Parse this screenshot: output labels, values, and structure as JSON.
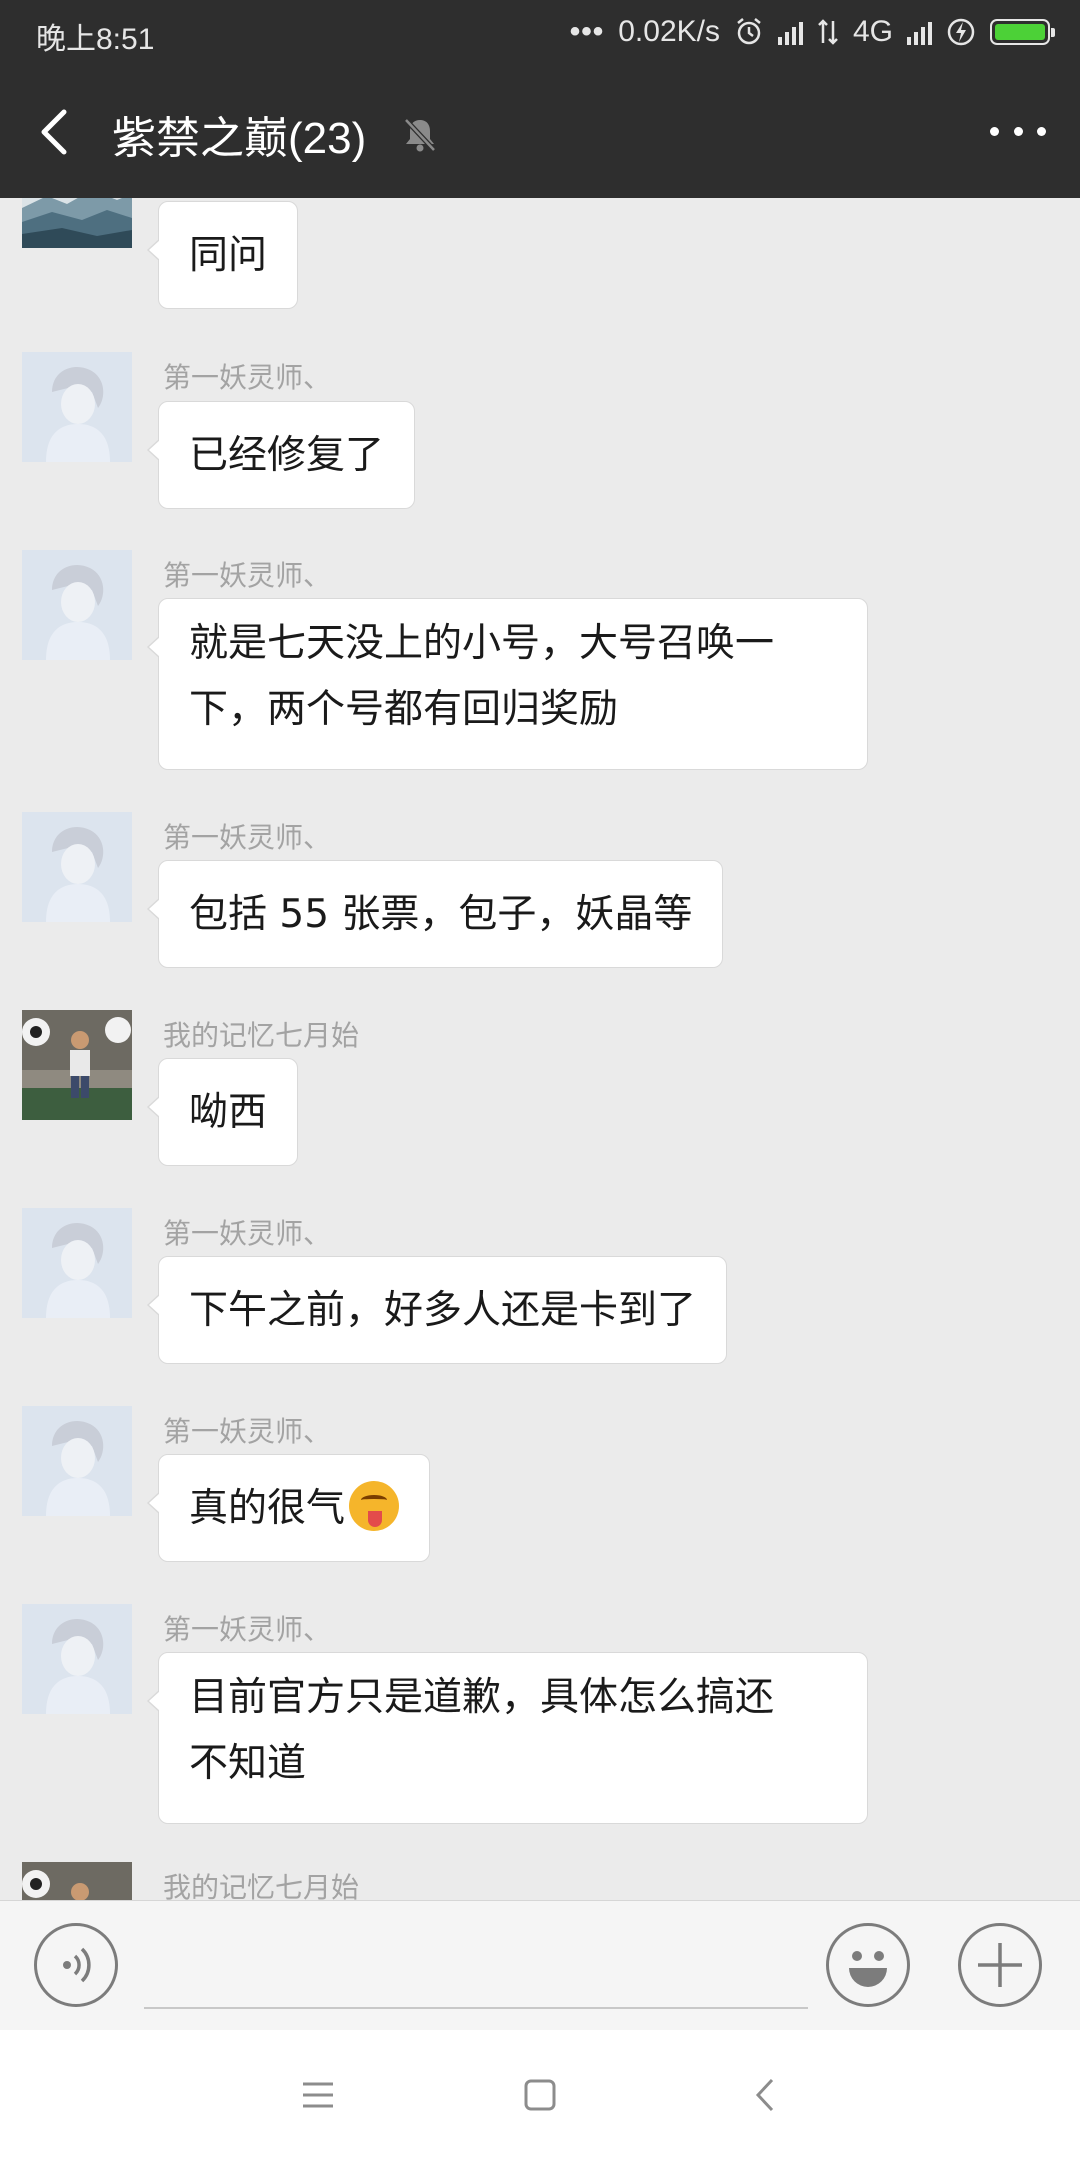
{
  "status_bar": {
    "time": "晚上8:51",
    "more": "•••",
    "net_speed": "0.02K/s",
    "network": "4G"
  },
  "header": {
    "title": "紫禁之巅(23)",
    "back_icon": "back-arrow-icon",
    "mute_icon": "bell-muted-icon",
    "more_icon": "more-dots-icon"
  },
  "messages": [
    {
      "sender": "",
      "text": "同问",
      "avatar": "landscape"
    },
    {
      "sender": "第一妖灵师、",
      "text": "已经修复了",
      "avatar": "anime"
    },
    {
      "sender": "第一妖灵师、",
      "lines": [
        "就是七天没上的小号，大号召唤一",
        "下，两个号都有回归奖励"
      ],
      "avatar": "anime"
    },
    {
      "sender": "第一妖灵师、",
      "text": "包括 55 张票，包子，妖晶等",
      "avatar": "anime"
    },
    {
      "sender": "我的记忆七月始",
      "text": "呦西",
      "avatar": "child"
    },
    {
      "sender": "第一妖灵师、",
      "text": "下午之前，好多人还是卡到了",
      "avatar": "anime"
    },
    {
      "sender": "第一妖灵师、",
      "text": "真的很气",
      "emoji": "tongue-out-emoji",
      "avatar": "anime"
    },
    {
      "sender": "第一妖灵师、",
      "lines": [
        "目前官方只是道歉，具体怎么搞还",
        "不知道"
      ],
      "avatar": "anime"
    },
    {
      "sender": "我的记忆七月始",
      "text": "",
      "avatar": "child"
    }
  ],
  "input_bar": {
    "placeholder": "",
    "voice_icon": "voice-icon",
    "emoji_icon": "emoji-icon",
    "plus_icon": "plus-icon"
  },
  "nav_bar": {
    "menu_icon": "menu-icon",
    "home_icon": "home-icon",
    "back_icon": "back-icon"
  },
  "colors": {
    "header_bg": "#2e2e2e",
    "chat_bg": "#ebebeb",
    "bubble_bg": "#ffffff",
    "sender_text": "#a3a3a3",
    "battery": "#4cd137"
  }
}
